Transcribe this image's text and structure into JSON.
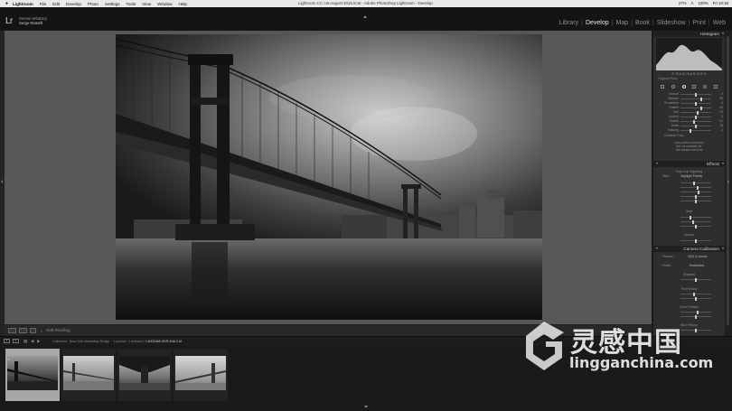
{
  "menubar": {
    "apple": "",
    "items": [
      "Lightroom",
      "File",
      "Edit",
      "Develop",
      "Photo",
      "Settings",
      "Tools",
      "View",
      "Window",
      "Help"
    ],
    "window_title": "Lightroom CC cat August 2015.lrcat - Adobe Photoshop Lightroom - Develop",
    "status": [
      "27%",
      "A",
      "100%",
      "Fri 10:18"
    ]
  },
  "identity_plate": {
    "logo": "Lr",
    "line1": "Serena Whalstry",
    "line2": "Serge Ramelli"
  },
  "modules": [
    "Library",
    "Develop",
    "Map",
    "Book",
    "Slideshow",
    "Print",
    "Web"
  ],
  "active_module": "Develop",
  "toolbar": {
    "soft_proofing": "Soft Proofing"
  },
  "right_panel": {
    "histogram_label": "Histogram",
    "histogram_info": "R  75.6  G  75.8  B  75.6 %",
    "original_photo": "Original Photo",
    "detail_sliders": [
      {
        "label": "Amount",
        "value": "0",
        "pos": 0.5
      },
      {
        "label": "Midpoint",
        "value": "50",
        "pos": 0.7
      },
      {
        "label": "Roundness",
        "value": "0",
        "pos": 0.5
      },
      {
        "label": "Feather",
        "value": "50",
        "pos": 0.7
      },
      {
        "label": "Size",
        "value": "25",
        "pos": 0.55
      },
      {
        "label": "Amount",
        "value": "0",
        "pos": 0.5
      },
      {
        "label": "Radius",
        "value": "1.0",
        "pos": 0.45
      },
      {
        "label": "Detail",
        "value": "25",
        "pos": 0.5
      },
      {
        "label": "Masking",
        "value": "0",
        "pos": 0.3
      }
    ],
    "constrain_crop": "Constrain Crop",
    "profile_note": [
      "Lens profile corrections",
      "are not available for",
      "this camera and lens"
    ],
    "effects_label": "Effects",
    "vignette_title": "Post-Crop Vignetting",
    "vignette_style_label": "Style :",
    "vignette_style": "Highlight Priority",
    "grain_label": "Grain",
    "dehaze_label": "Dehaze",
    "camera_calibration_label": "Camera Calibration",
    "process_label": "Process :",
    "process_value": "2012 (Current)",
    "profile_label": "Profile :",
    "profile_value": "Embedded",
    "shadows_label": "Shadows",
    "red_primary_label": "Red Primary",
    "green_primary_label": "Green Primary",
    "blue_primary_label": "Blue Primary"
  },
  "filmstrip": {
    "page_numbers": [
      "1",
      "2"
    ],
    "path_prefix": "Collection : New York Manhattan Bridge",
    "path_info": "4 photos / 1 selected /",
    "selected_file": "L4002948-HDR-Edit-2.tif",
    "thumbs": [
      {
        "badge": "1",
        "selected": true
      },
      {
        "badge": "",
        "selected": false
      },
      {
        "badge": "",
        "selected": false
      },
      {
        "badge": "",
        "selected": false
      }
    ]
  },
  "watermark": {
    "cn": "灵感中国",
    "url": "lingganchina.com"
  },
  "colors": {
    "accent": "#e6e6e6",
    "panel": "#2e2e2e",
    "canvas": "#575757"
  }
}
